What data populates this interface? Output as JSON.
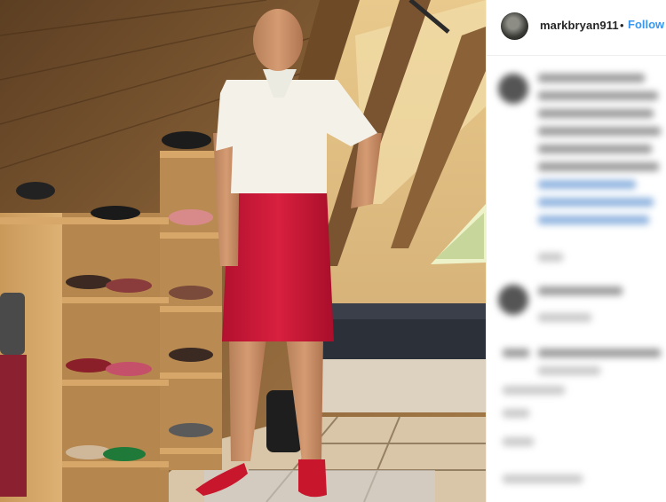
{
  "post": {
    "username": "markbryan911",
    "separator": "•",
    "follow_label": "Follow"
  },
  "icons": {
    "avatar": "profile-avatar",
    "comment_avatar": "commenter-avatar"
  },
  "colors": {
    "follow": "#3897f0",
    "username": "#262626",
    "skirt": "#d0183e"
  }
}
